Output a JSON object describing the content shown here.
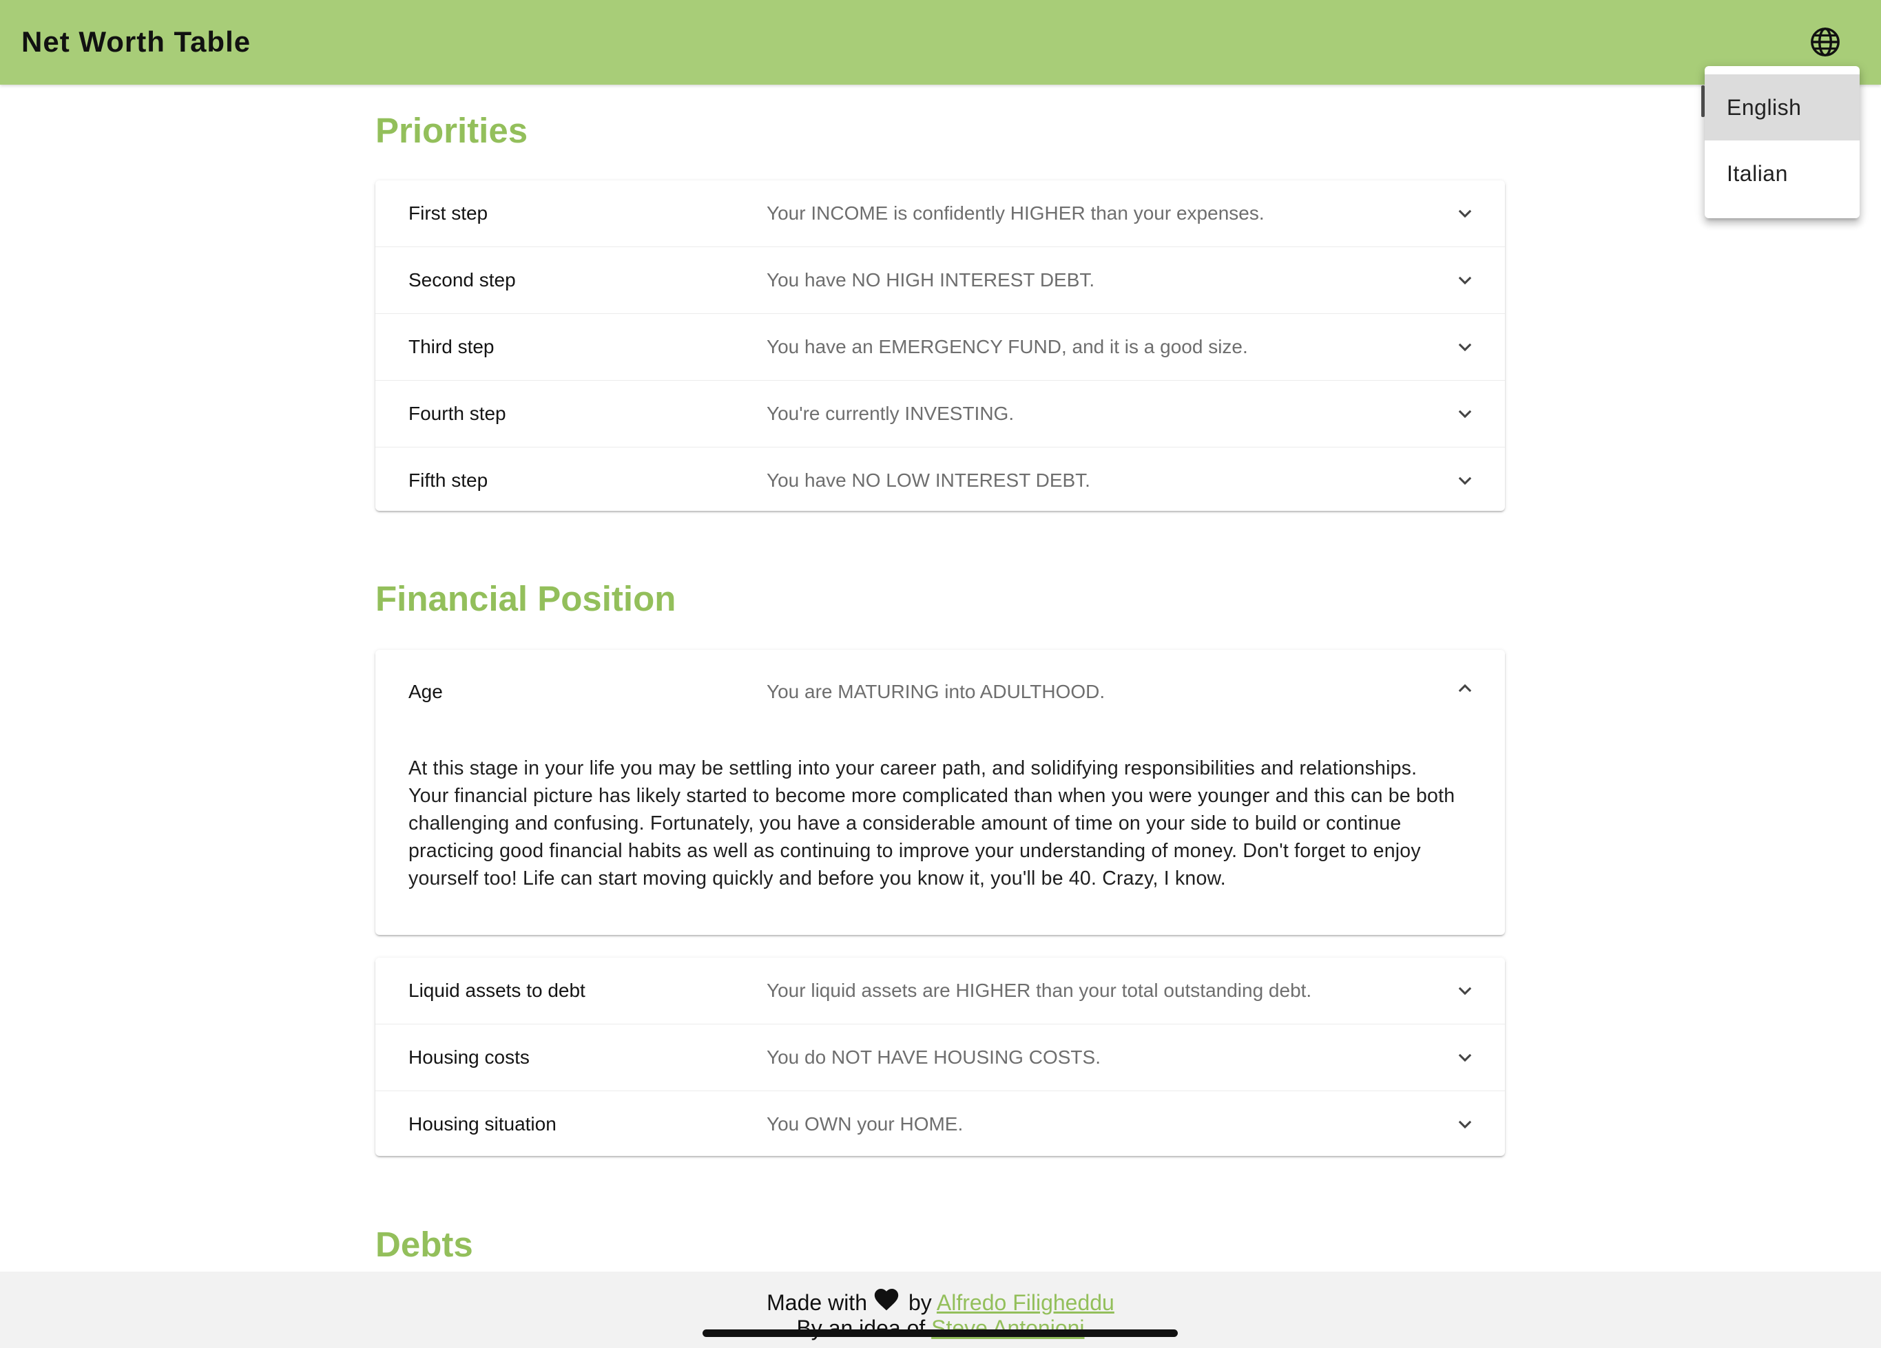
{
  "header": {
    "title": "Net Worth Table",
    "language_icon": "globe-icon"
  },
  "language_menu": {
    "options": [
      "English",
      "Italian"
    ],
    "selected": "English"
  },
  "priorities": {
    "title": "Priorities",
    "rows": [
      {
        "label": "First step",
        "value": "Your INCOME is confidently HIGHER than your expenses."
      },
      {
        "label": "Second step",
        "value": "You have NO HIGH INTEREST DEBT."
      },
      {
        "label": "Third step",
        "value": "You have an EMERGENCY FUND, and it is a good size."
      },
      {
        "label": "Fourth step",
        "value": "You're currently INVESTING."
      },
      {
        "label": "Fifth step",
        "value": "You have NO LOW INTEREST DEBT."
      }
    ]
  },
  "financial_position": {
    "title": "Financial Position",
    "age": {
      "label": "Age",
      "value": "You are MATURING into ADULTHOOD.",
      "lines": [
        "At this stage in your life you may be settling into your career path, and solidifying responsibilities and relationships.",
        "Your financial picture has likely started to become more complicated than when you were younger and this can be both",
        "challenging and confusing. Fortunately, you have a considerable amount of time on your side to build or continue",
        "practicing good financial habits as well as continuing to improve your understanding of money. Don't forget to enjoy",
        "yourself too! Life can start moving quickly and before you know it, you'll be 40. Crazy, I know."
      ]
    },
    "rows": [
      {
        "label": "Liquid assets to debt",
        "value": "Your liquid assets are HIGHER than your total outstanding debt."
      },
      {
        "label": "Housing costs",
        "value": "You do NOT HAVE HOUSING COSTS."
      },
      {
        "label": "Housing situation",
        "value": "You OWN your HOME."
      }
    ]
  },
  "debts": {
    "title": "Debts"
  },
  "footer": {
    "made_with": "Made with",
    "by": "by",
    "author": "Alfredo Filigheddu",
    "idea_prefix": "By an idea of",
    "idea_author": "Steve Antonioni"
  },
  "icons": {
    "expand": "chevron-down-icon",
    "collapse": "chevron-up-icon",
    "heart": "heart-icon"
  },
  "colors": {
    "header": "#a8cd78",
    "accent": "#93bf5b",
    "footer_bg": "#f2f2f2"
  }
}
